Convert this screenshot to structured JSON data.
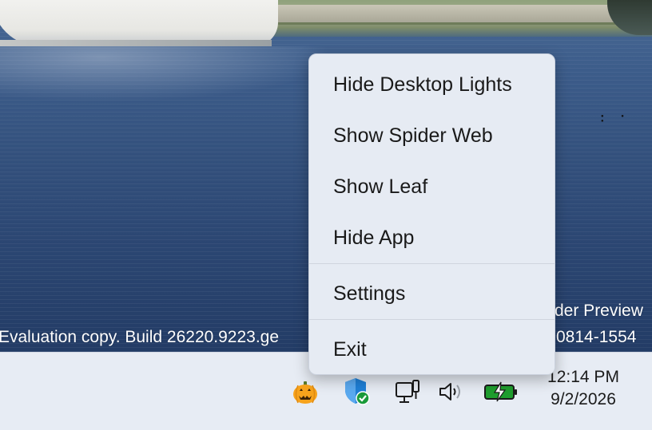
{
  "desktop": {
    "watermark_left": "Evaluation copy. Build 26220.9223.ge",
    "watermark_right_line1": "der Preview",
    "watermark_right_line2": "0814-1554"
  },
  "context_menu": {
    "items": [
      {
        "label": "Hide Desktop Lights"
      },
      {
        "label": "Show Spider Web"
      },
      {
        "label": "Show Leaf"
      },
      {
        "label": "Hide App"
      },
      {
        "label": "Settings"
      },
      {
        "label": "Exit"
      }
    ]
  },
  "tray": {
    "icons": [
      "pumpkin-icon",
      "security-shield-icon",
      "network-icon",
      "volume-icon",
      "battery-charging-icon"
    ],
    "time": "12:14 PM",
    "date": "9/2/2026"
  },
  "colors": {
    "menu_background": "#e6ebf3",
    "taskbar_background": "#e7ecf4",
    "pumpkin": "#f7a31c",
    "shield": "#1f7fd6",
    "battery_fill": "#1f9d2e"
  }
}
